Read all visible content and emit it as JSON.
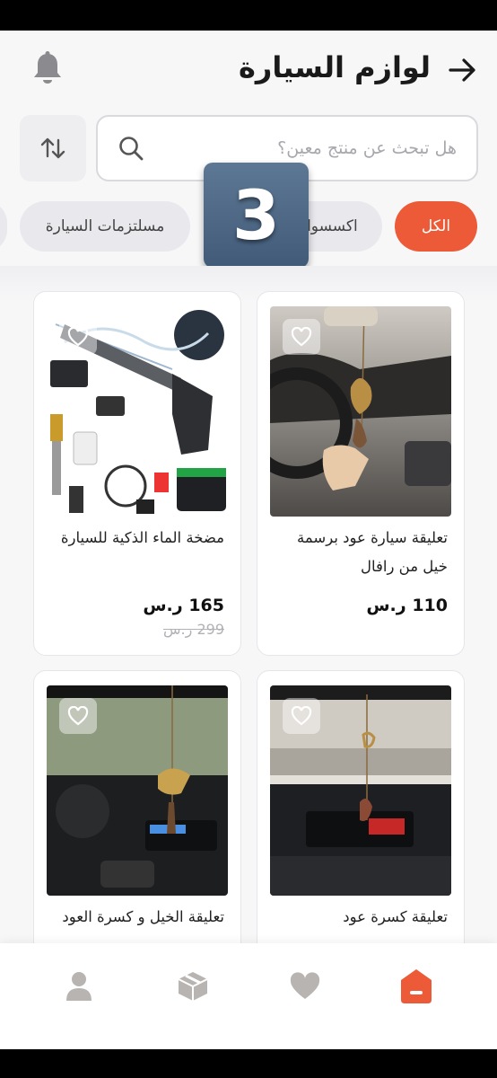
{
  "header": {
    "title": "لوازم السيارة",
    "back_icon": "arrow-right-icon",
    "notification_icon": "bell-icon"
  },
  "search": {
    "placeholder": "هل تبحث عن منتج معين؟",
    "value": "",
    "icon": "search-icon",
    "sort_icon": "sort-arrows-icon"
  },
  "chips": [
    {
      "label": "الكل",
      "active": true
    },
    {
      "label": "اكسسوارات السيارة",
      "active": false
    },
    {
      "label": "مسلتزمات السيارة",
      "active": false
    }
  ],
  "overlay_badge": "3",
  "products": [
    {
      "title": "تعليقة سيارة عود برسمة خيل من رافال",
      "price": "110 ر.س",
      "old_price": ""
    },
    {
      "title": "مضخة الماء الذكية للسيارة",
      "price": "165 ر.س",
      "old_price": "299 ر.س"
    },
    {
      "title": "تعليقة كسرة عود",
      "price": "",
      "old_price": ""
    },
    {
      "title": "تعليقة الخيل و كسرة العود",
      "price": "",
      "old_price": ""
    }
  ],
  "bottom_nav": [
    {
      "name": "home",
      "icon": "home-icon",
      "active": true
    },
    {
      "name": "favorites",
      "icon": "heart-icon",
      "active": false
    },
    {
      "name": "orders",
      "icon": "box-icon",
      "active": false
    },
    {
      "name": "profile",
      "icon": "user-icon",
      "active": false
    }
  ],
  "colors": {
    "accent": "#ec5a37",
    "chip_bg": "#e8e8ed",
    "nav_inactive": "#b8b4b2",
    "text": "#1a1a1a"
  }
}
